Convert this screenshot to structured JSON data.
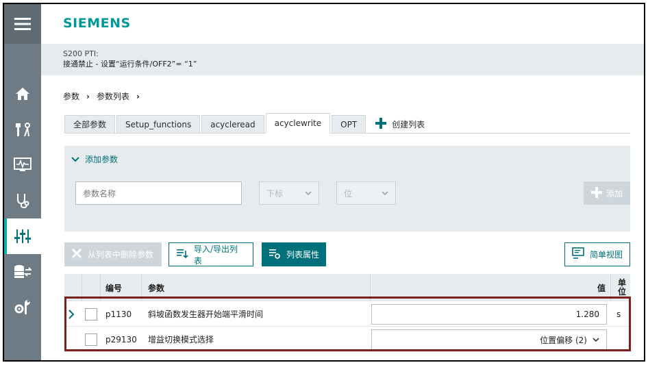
{
  "header": {
    "logo": "SIEMENS"
  },
  "info": {
    "device": "S200 PTI:",
    "status": "接通禁止 - 设置“运行条件/OFF2”= “1”"
  },
  "nav": {
    "menu_icon": "hamburger-icon",
    "items": [
      {
        "icon": "home-icon"
      },
      {
        "icon": "tools-icon"
      },
      {
        "icon": "monitor-icon"
      },
      {
        "icon": "stethoscope-icon"
      },
      {
        "icon": "sliders-icon",
        "active": true
      },
      {
        "icon": "database-transfer-icon"
      },
      {
        "icon": "settings-wrench-icon"
      }
    ]
  },
  "breadcrumb": {
    "items": [
      "参数",
      "参数列表"
    ],
    "separator": "›"
  },
  "tabs": {
    "items": [
      "全部参数",
      "Setup_functions",
      "acycleread",
      "acyclewrite",
      "OPT"
    ],
    "active": "acyclewrite",
    "create_label": "创建列表"
  },
  "add_panel": {
    "title": "添加参数",
    "name_placeholder": "参数名称",
    "index_select": "下标",
    "bit_select": "位",
    "add_button": "添加"
  },
  "toolbar": {
    "remove_label": "从列表中删除参数",
    "import_export_label": "导入/导出列表",
    "properties_label": "列表属性",
    "simple_view_label": "简单视图"
  },
  "table": {
    "headers": {
      "number": "编号",
      "param": "参数",
      "value": "值",
      "unit": "单位"
    },
    "rows": [
      {
        "number": "p1130",
        "param": "斜坡函数发生器开始端平滑时间",
        "value": "1.280",
        "unit": "s"
      },
      {
        "number": "p29130",
        "param": "增益切换模式选择",
        "value": "位置偏移 (2)",
        "unit": ""
      }
    ]
  },
  "colors": {
    "accent": "#009999",
    "primary": "#00707a",
    "highlight": "#7a2020"
  }
}
